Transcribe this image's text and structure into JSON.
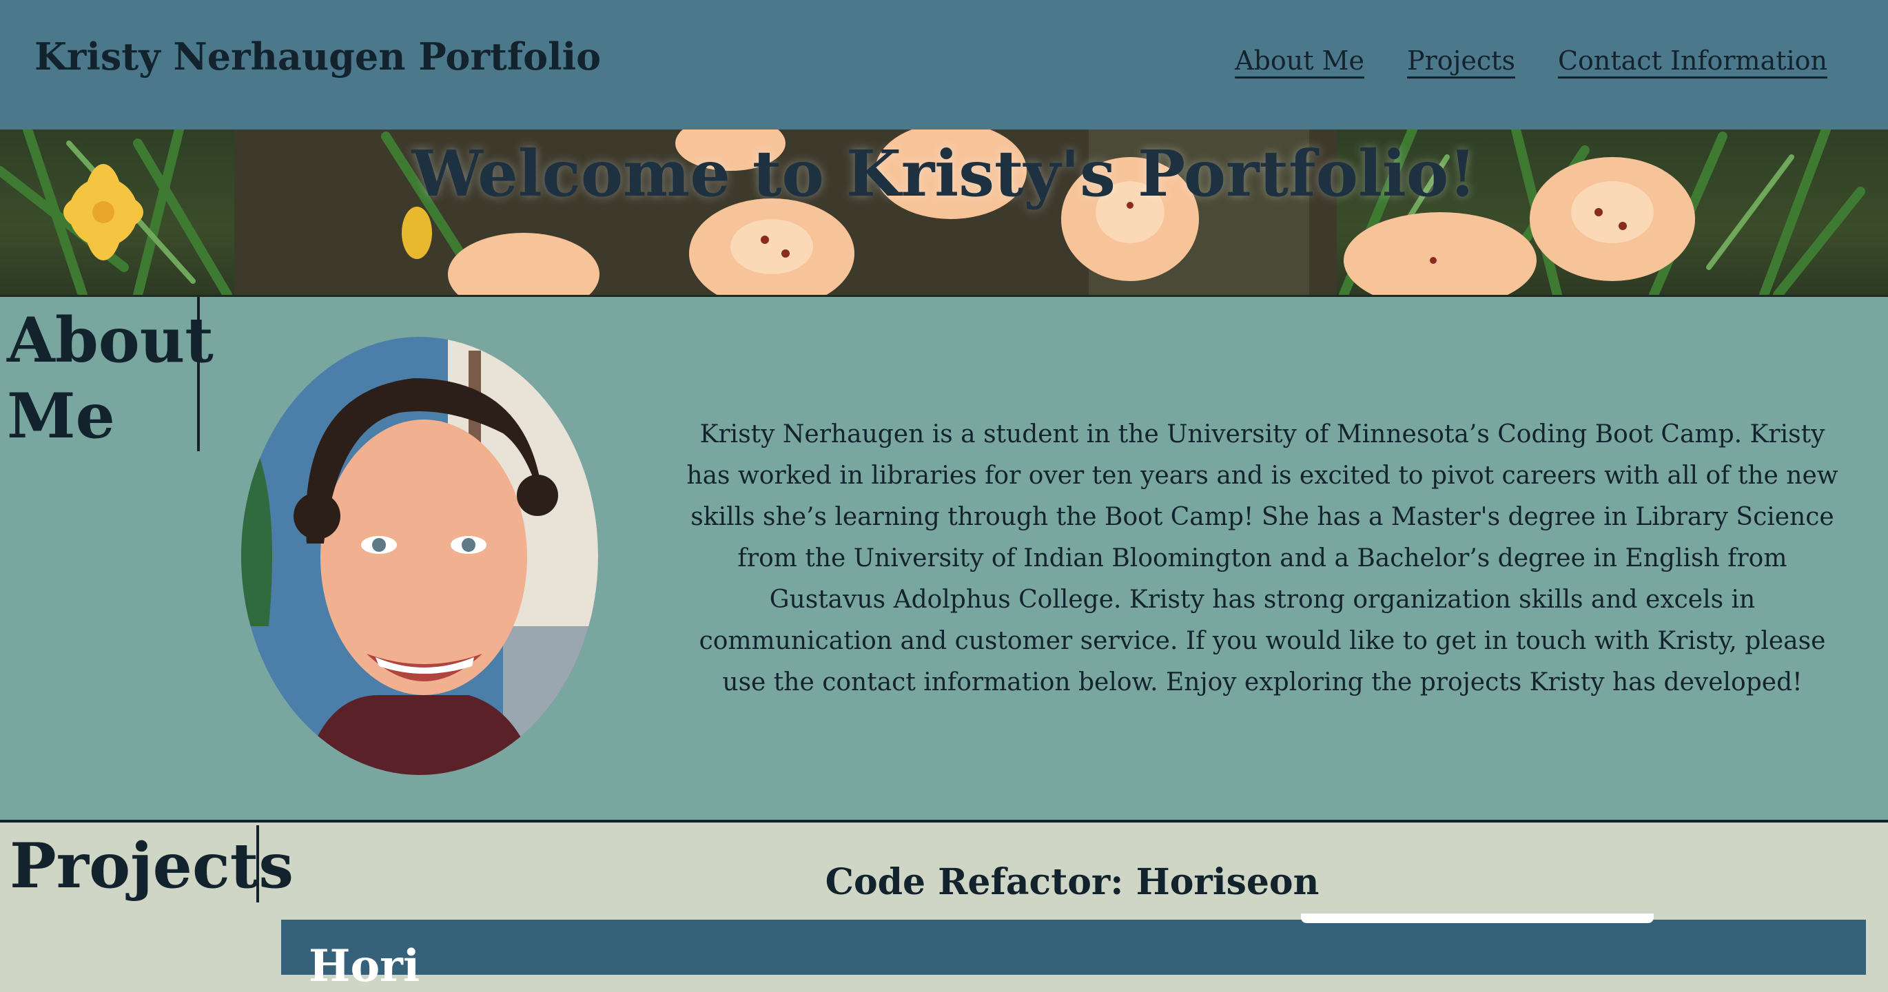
{
  "header": {
    "site_title": "Kristy Nerhaugen Portfolio",
    "nav": [
      {
        "label": "About Me"
      },
      {
        "label": "Projects"
      },
      {
        "label": "Contact Information"
      }
    ]
  },
  "hero": {
    "title": "Welcome to Kristy's Portfolio!"
  },
  "about": {
    "heading": "About Me",
    "text": "Kristy Nerhaugen is a student in the University of Minnesota’s Coding Boot Camp. Kristy has worked in libraries for over ten years and is excited to pivot careers with all of the new skills she’s learning through the Boot Camp! She has a Master's degree in Library Science from the University of Indian Bloomington and a Bachelor’s degree in English from Gustavus Adolphus College. Kristy has strong organization skills and excels in communication and customer service. If you would like to get in touch with Kristy, please use the contact information below. Enjoy exploring the projects Kristy has developed!"
  },
  "projects": {
    "heading": "Projects",
    "items": [
      {
        "title": "Code Refactor: Horiseon",
        "card_text": "Hori"
      }
    ]
  },
  "colors": {
    "header_bg": "#4c788c",
    "about_bg": "#7aa6a0",
    "projects_bg": "#cfd6c5",
    "card_bg": "#36617a",
    "text": "#13232d"
  }
}
